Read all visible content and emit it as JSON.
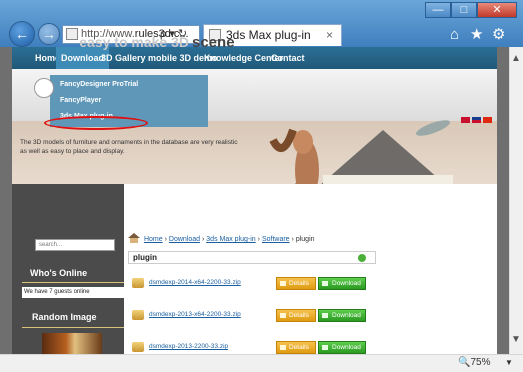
{
  "browser": {
    "address_prefix": "http://www.",
    "address_domain": "rules3d.c...",
    "address_tools": "ρ ▾ ↻",
    "tab_title": "3ds Max plug-in",
    "tab_close": "×",
    "zoom": "75%",
    "icons": [
      "back-arrow-icon",
      "forward-arrow-icon",
      "home-icon",
      "star-icon",
      "gear-icon",
      "minimize-icon",
      "maximize-icon",
      "close-icon"
    ]
  },
  "site_nav": {
    "items": [
      "Home",
      "Download",
      "3D Gallery",
      "mobile 3D demo",
      "Knowledge Center",
      "Contact"
    ],
    "active": "Download"
  },
  "dropdown": {
    "items": [
      "FancyDesigner ProTrial",
      "FancyPlayer",
      "3ds Max plug-in"
    ],
    "highlighted": "3ds Max plug-in"
  },
  "hero": {
    "title": "scene",
    "title_faded": "easy to make 3D",
    "description": "The 3D models of furniture and ornaments in the database are very realistic as well as easy to place and display."
  },
  "sidebar": {
    "search_placeholder": "search...",
    "whos_online_title": "Who's Online",
    "guests_text": "We have 7 guests online",
    "random_image_title": "Random Image"
  },
  "breadcrumb": {
    "items": [
      "Home",
      "Download",
      "3ds Max plug-in",
      "Software",
      "plugin"
    ],
    "separator": "›"
  },
  "path_box": "plugin",
  "files": [
    {
      "name": "dsmdexp-2014-x64-2200-33.zip",
      "details_label": "Details",
      "download_label": "Download"
    },
    {
      "name": "dsmdexp-2013-x64-2200-33.zip",
      "details_label": "Details",
      "download_label": "Download"
    },
    {
      "name": "dsmdexp-2013-2200-33.zip",
      "details_label": "Details",
      "download_label": "Download"
    }
  ],
  "colors": {
    "titlebar": "#4f8fca",
    "site_nav": "#235f82",
    "details_button": "#f0ad22",
    "download_button": "#3cb032",
    "highlight_ring": "#e01010"
  }
}
